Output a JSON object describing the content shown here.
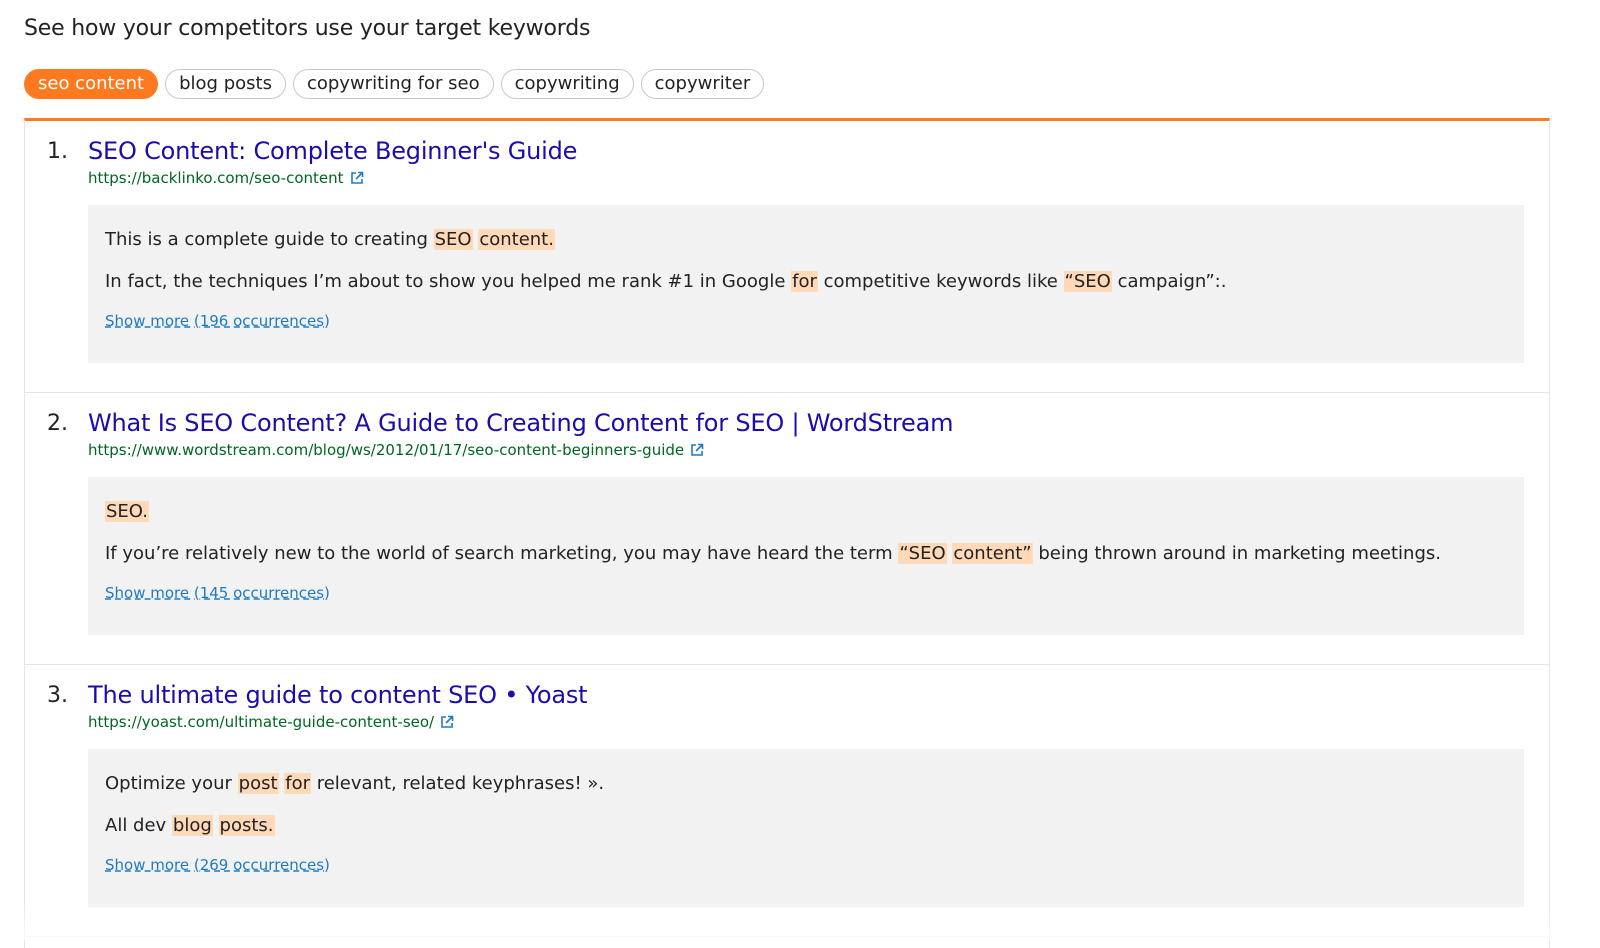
{
  "heading": "See how your competitors use your target keywords",
  "keywords": [
    {
      "label": "seo content",
      "active": true
    },
    {
      "label": "blog posts",
      "active": false
    },
    {
      "label": "copywriting for seo",
      "active": false
    },
    {
      "label": "copywriting",
      "active": false
    },
    {
      "label": "copywriter",
      "active": false
    }
  ],
  "results": [
    {
      "rank": "1.",
      "title": "SEO Content: Complete Beginner's Guide",
      "url": "https://backlinko.com/seo-content",
      "lines": [
        [
          {
            "t": "This is a complete guide to creating ",
            "h": false
          },
          {
            "t": "SEO",
            "h": true
          },
          {
            "t": " ",
            "h": false
          },
          {
            "t": "content.",
            "h": true
          }
        ],
        [
          {
            "t": "In fact, the techniques I’m about to show you helped me rank #1 in Google ",
            "h": false
          },
          {
            "t": "for",
            "h": true
          },
          {
            "t": " competitive keywords like ",
            "h": false
          },
          {
            "t": "“SEO",
            "h": true
          },
          {
            "t": " campaign”:.",
            "h": false
          }
        ]
      ],
      "show_more": "Show more (196 occurrences)"
    },
    {
      "rank": "2.",
      "title": "What Is SEO Content? A Guide to Creating Content for SEO | WordStream",
      "url": "https://www.wordstream.com/blog/ws/2012/01/17/seo-content-beginners-guide",
      "lines": [
        [
          {
            "t": "SEO.",
            "h": true
          }
        ],
        [
          {
            "t": "If you’re relatively new to the world of search marketing, you may have heard the term ",
            "h": false
          },
          {
            "t": "“SEO",
            "h": true
          },
          {
            "t": " ",
            "h": false
          },
          {
            "t": "content”",
            "h": true
          },
          {
            "t": " being thrown around in marketing meetings.",
            "h": false
          }
        ]
      ],
      "show_more": "Show more (145 occurrences)"
    },
    {
      "rank": "3.",
      "title": "The ultimate guide to content SEO • Yoast",
      "url": "https://yoast.com/ultimate-guide-content-seo/",
      "lines": [
        [
          {
            "t": "Optimize your ",
            "h": false
          },
          {
            "t": "post",
            "h": true
          },
          {
            "t": " ",
            "h": false
          },
          {
            "t": "for",
            "h": true
          },
          {
            "t": " relevant, related keyphrases! ».",
            "h": false
          }
        ],
        [
          {
            "t": "All dev ",
            "h": false
          },
          {
            "t": "blog",
            "h": true
          },
          {
            "t": " ",
            "h": false
          },
          {
            "t": "posts.",
            "h": true
          }
        ]
      ],
      "show_more": "Show more (269 occurrences)"
    }
  ],
  "colors": {
    "accent": "#ff7a1f",
    "highlight": "#ffd9b8",
    "title_link": "#1a0dab",
    "url": "#006621",
    "show_more": "#1f7bc1"
  },
  "icons": {
    "external": "external-link-icon"
  }
}
